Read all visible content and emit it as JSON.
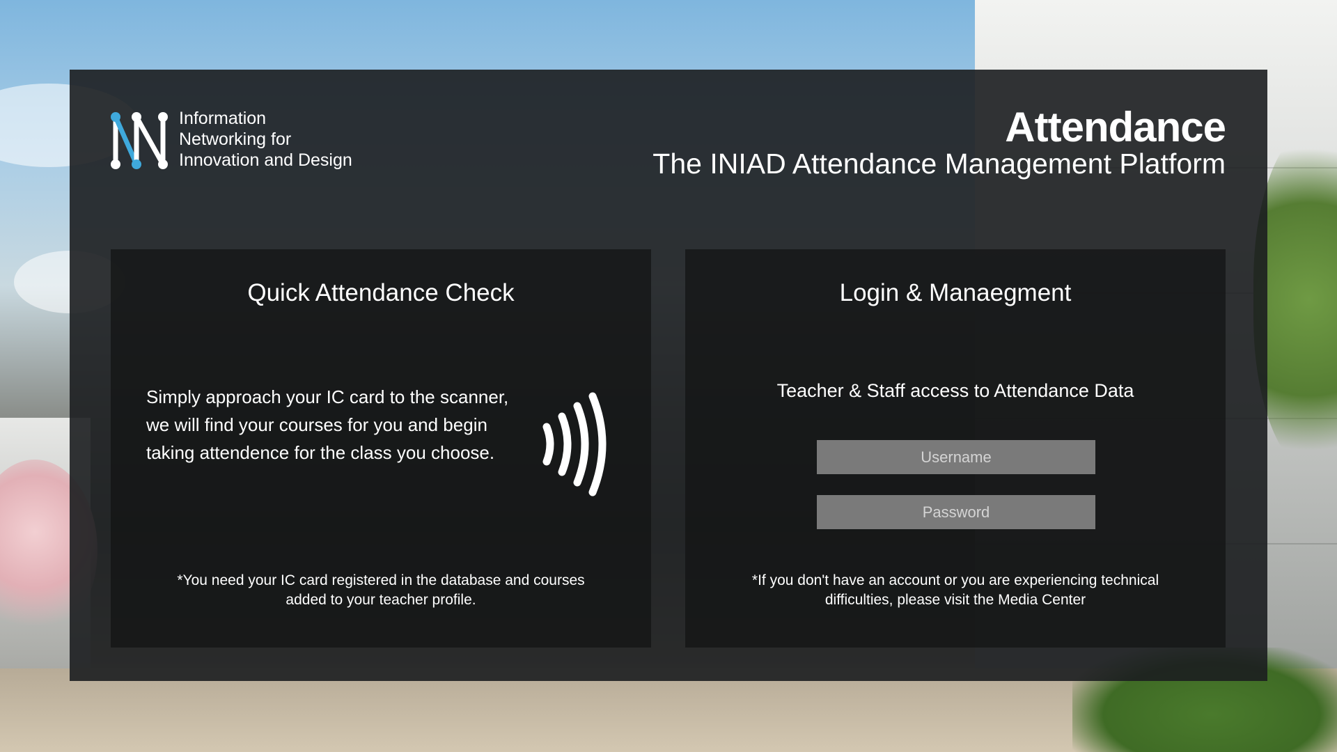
{
  "logo": {
    "lines": [
      "Information",
      "Networking for",
      "Innovation and Design"
    ]
  },
  "header": {
    "title": "Attendance",
    "subtitle": "The INIAD Attendance Management Platform"
  },
  "quick_check": {
    "title": "Quick Attendance Check",
    "description": "Simply approach your IC card to the scanner, we will find your courses for you and begin taking attendence for the class you choose.",
    "note_line1": "*You need your IC card registered in the database and courses",
    "note_line2": "added to your teacher profile.",
    "icon": "nfc-contactless-icon"
  },
  "login": {
    "title": "Login & Manaegment",
    "subtitle": "Teacher & Staff access to Attendance Data",
    "username_placeholder": "Username",
    "password_placeholder": "Password",
    "note_line1": "*If you don't have an account or you are experiencing technical",
    "note_line2": "difficulties, please visit the Media Center"
  },
  "colors": {
    "logo_blue": "#3fa9dc",
    "panel": "#1c1e20",
    "field": "#7a7a7a"
  }
}
